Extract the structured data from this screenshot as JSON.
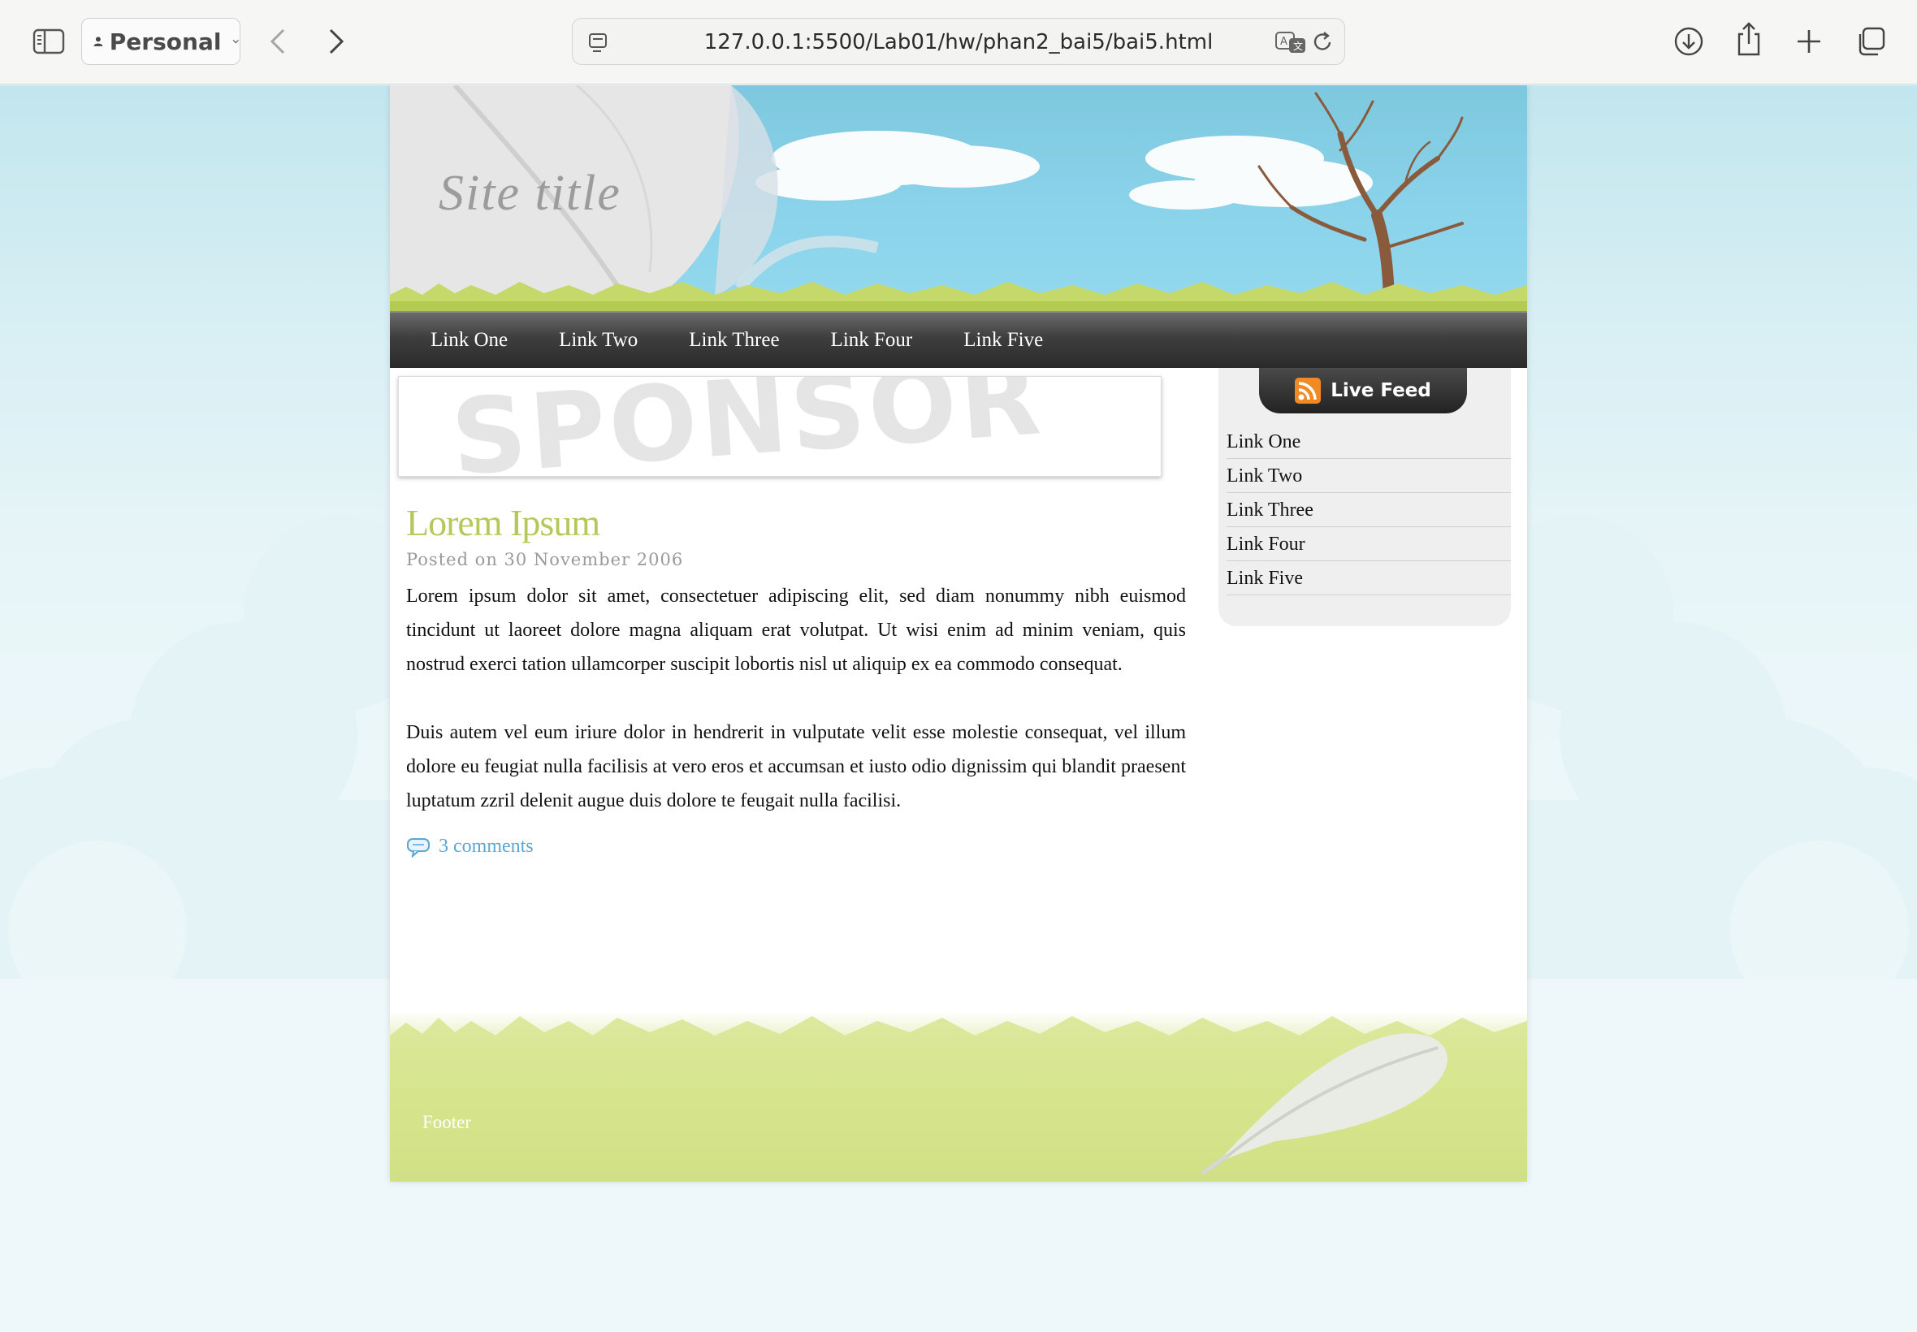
{
  "browser": {
    "profile_label": "Personal",
    "url": "127.0.0.1:5500/Lab01/hw/phan2_bai5/bai5.html",
    "icons": [
      "sidebar-icon",
      "person-icon",
      "chevron-down-icon",
      "back-arrow-icon",
      "forward-arrow-icon",
      "page-icon",
      "translate-icon",
      "reload-icon",
      "download-icon",
      "share-icon",
      "plus-icon",
      "tabs-icon"
    ]
  },
  "site": {
    "title": "Site title",
    "nav": [
      {
        "label": "Link One"
      },
      {
        "label": "Link Two"
      },
      {
        "label": "Link Three"
      },
      {
        "label": "Link Four"
      },
      {
        "label": "Link Five"
      }
    ],
    "sponsor_text": "SPONSOR",
    "post": {
      "title": "Lorem Ipsum",
      "meta": "Posted on 30 November 2006",
      "paragraphs": [
        "Lorem ipsum dolor sit amet, consectetuer adipiscing elit, sed diam nonummy nibh euismod tincidunt ut laoreet dolore magna aliquam erat volutpat. Ut wisi enim ad minim veniam, quis nostrud exerci tation ullamcorper suscipit lobortis nisl ut aliquip ex ea commodo consequat.",
        "Duis autem vel eum iriure dolor in hendrerit in vulputate velit esse molestie consequat, vel illum dolore eu feugiat nulla facilisis at vero eros et accumsan et iusto odio dignissim qui blandit praesent luptatum zzril delenit augue duis dolore te feugait nulla facilisi."
      ],
      "comments": "3 comments"
    },
    "sidebar": {
      "feed_label": "Live Feed",
      "links": [
        {
          "label": "Link One"
        },
        {
          "label": "Link Two"
        },
        {
          "label": "Link Three"
        },
        {
          "label": "Link Four"
        },
        {
          "label": "Link Five"
        }
      ]
    },
    "footer": "Footer"
  },
  "colors": {
    "post_title": "#b6c85a",
    "comments_link": "#5aa6d4",
    "nav_bg": "#2a2a2a",
    "sky": "#8ad3ea",
    "grass": "#c2d565"
  }
}
